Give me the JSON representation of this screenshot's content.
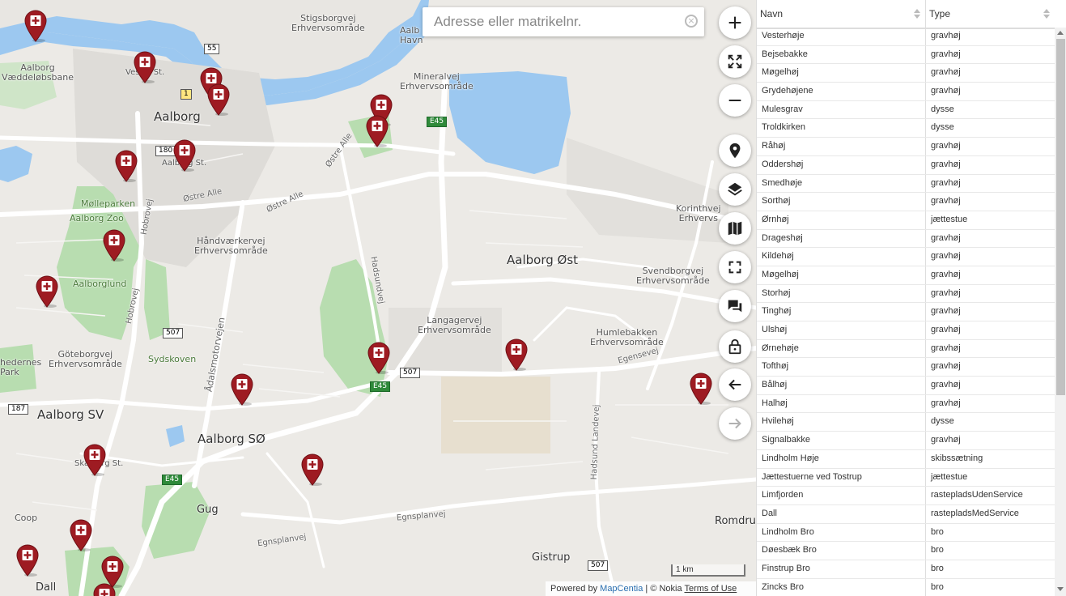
{
  "search": {
    "placeholder": "Adresse eller matrikelnr."
  },
  "map_labels": {
    "aalborg": "Aalborg",
    "aalborg_ost": "Aalborg Øst",
    "aalborg_sv": "Aalborg SV",
    "aalborg_so": "Aalborg SØ",
    "gug": "Gug",
    "gistrup": "Gistrup",
    "dall": "Dall",
    "romdru": "Romdru",
    "coop": "Coop",
    "stigsborgvej": "Stigsborgvej\nErhvervsområde",
    "aalborg_havn": "Aalb\nHavn",
    "mineralvej": "Mineralvej\nErhvervsområde",
    "korinthvej": "Korinthvej\nErhvervs",
    "svendborgvej": "Svendborgvej\nErhvervsområde",
    "humlebakken": "Humlebakken\nErhvervsområde",
    "langagervej": "Langagervej\nErhvervsområde",
    "haandvaerkervej": "Håndværkervej\nErhvervsområde",
    "goteborgvej": "Göteborgvej\nErhvervsområde",
    "molleparken": "Mølleparken",
    "aalborg_zoo": "Aalborg Zoo",
    "aalborglund": "Aalborglund",
    "sydskoven": "Sydskoven",
    "vaeddelobsbane": "Aalborg\nVæddeløbsbane",
    "hedernes_park": "hedernes\nPark",
    "vesterbro_st": "Vester St.",
    "aalborg_st": "Aalborg St.",
    "skalborg_st": "Skalborg St.",
    "ostre_alle_1": "Østre Alle",
    "ostre_alle_2": "Østre Alle",
    "ostre_alle_3": "Østre Alle",
    "hobrovej_1": "Hobrovej",
    "hobrovej_2": "Hobrovej",
    "adalsmotorvejen": "Ådalsmotorvejen",
    "hadsundvej": "Hadsundvej",
    "hadsund_landevej": "Hadsund Landevej",
    "egensevej": "Egensevej",
    "egnsplanvej_1": "Egnsplanvej",
    "egnsplanvej_2": "Egnsplanvej",
    "r55": "55",
    "r1": "1",
    "r180": "180",
    "r507a": "507",
    "r507b": "507",
    "r507c": "507",
    "r187": "187",
    "e45a": "E45",
    "e45b": "E45",
    "e45c": "E45"
  },
  "scale": "1 km",
  "attribution": {
    "powered": "Powered by ",
    "link": "MapCentia",
    "sep": " | © Nokia ",
    "terms": "Terms of Use"
  },
  "controls": {
    "zoom_in": "plus-icon",
    "extent": "expand-arrows-icon",
    "zoom_out": "minus-icon",
    "location": "location-pin-icon",
    "layers": "layers-icon",
    "baselayer": "map-icon",
    "fullscreen": "fullscreen-icon",
    "comment": "chat-bubble-icon",
    "lock": "lock-icon",
    "back": "arrow-left-icon",
    "forward": "arrow-right-icon"
  },
  "marker_color": "#9e1b22",
  "table": {
    "headers": {
      "name": "Navn",
      "type": "Type"
    },
    "rows": [
      {
        "name": "Vesterhøje",
        "type": "gravhøj"
      },
      {
        "name": "Bejsebakke",
        "type": "gravhøj"
      },
      {
        "name": "Møgelhøj",
        "type": "gravhøj"
      },
      {
        "name": "Grydehøjene",
        "type": "gravhøj"
      },
      {
        "name": "Mulesgrav",
        "type": "dysse"
      },
      {
        "name": "Troldkirken",
        "type": "dysse"
      },
      {
        "name": "Råhøj",
        "type": "gravhøj"
      },
      {
        "name": "Oddershøj",
        "type": "gravhøj"
      },
      {
        "name": "Smedhøje",
        "type": "gravhøj"
      },
      {
        "name": "Sorthøj",
        "type": "gravhøj"
      },
      {
        "name": "Ørnhøj",
        "type": "jættestue"
      },
      {
        "name": "Drageshøj",
        "type": "gravhøj"
      },
      {
        "name": "Kildehøj",
        "type": "gravhøj"
      },
      {
        "name": "Møgelhøj",
        "type": "gravhøj"
      },
      {
        "name": "Storhøj",
        "type": "gravhøj"
      },
      {
        "name": "Tinghøj",
        "type": "gravhøj"
      },
      {
        "name": "Ulshøj",
        "type": "gravhøj"
      },
      {
        "name": "Ørnehøje",
        "type": "gravhøj"
      },
      {
        "name": "Tofthøj",
        "type": "gravhøj"
      },
      {
        "name": "Bålhøj",
        "type": "gravhøj"
      },
      {
        "name": "Halhøj",
        "type": "gravhøj"
      },
      {
        "name": "Hvilehøj",
        "type": "dysse"
      },
      {
        "name": "Signalbakke",
        "type": "gravhøj"
      },
      {
        "name": "Lindholm Høje",
        "type": "skibssætning"
      },
      {
        "name": "Jættestuerne ved Tostrup",
        "type": "jættestue"
      },
      {
        "name": "Limfjorden",
        "type": "rastepladsUdenService"
      },
      {
        "name": "Dall",
        "type": "rastepladsMedService"
      },
      {
        "name": "Lindholm Bro",
        "type": "bro"
      },
      {
        "name": "Døesbæk Bro",
        "type": "bro"
      },
      {
        "name": "Finstrup Bro",
        "type": "bro"
      },
      {
        "name": "Zincks Bro",
        "type": "bro"
      }
    ]
  }
}
